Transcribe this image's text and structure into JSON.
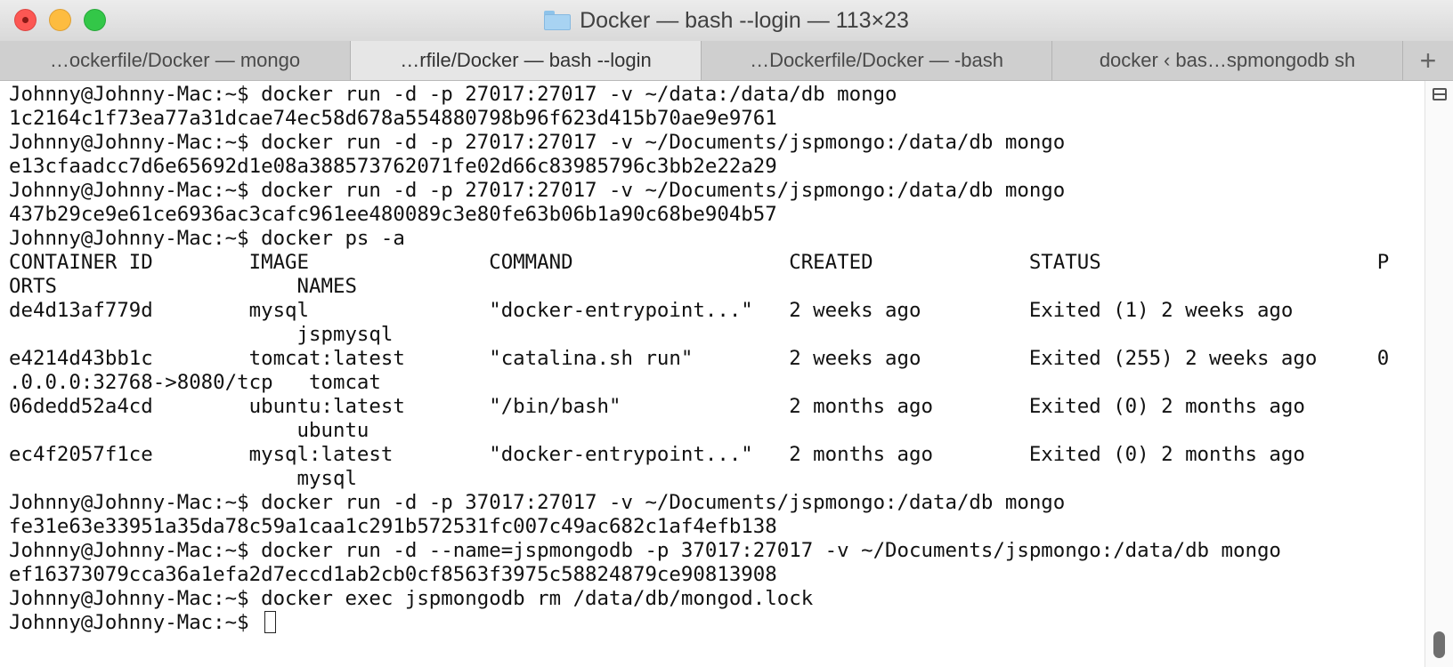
{
  "window": {
    "title": "Docker — bash --login — 113×23"
  },
  "tabs": [
    {
      "label": "…ockerfile/Docker — mongo",
      "active": false
    },
    {
      "label": "…rfile/Docker — bash --login",
      "active": true
    },
    {
      "label": "…Dockerfile/Docker — -bash",
      "active": false
    },
    {
      "label": "docker ‹ bas…spmongodb sh",
      "active": false
    }
  ],
  "add_tab_label": "+",
  "terminal": {
    "lines": [
      "Johnny@Johnny-Mac:~$ docker run -d -p 27017:27017 -v ~/data:/data/db mongo",
      "1c2164c1f73ea77a31dcae74ec58d678a554880798b96f623d415b70ae9e9761",
      "Johnny@Johnny-Mac:~$ docker run -d -p 27017:27017 -v ~/Documents/jspmongo:/data/db mongo",
      "e13cfaadcc7d6e65692d1e08a388573762071fe02d66c83985796c3bb2e22a29",
      "Johnny@Johnny-Mac:~$ docker run -d -p 27017:27017 -v ~/Documents/jspmongo:/data/db mongo",
      "437b29ce9e61ce6936ac3cafc961ee480089c3e80fe63b06b1a90c68be904b57",
      "Johnny@Johnny-Mac:~$ docker ps -a",
      "CONTAINER ID        IMAGE               COMMAND                  CREATED             STATUS                       P",
      "ORTS                    NAMES",
      "de4d13af779d        mysql               \"docker-entrypoint...\"   2 weeks ago         Exited (1) 2 weeks ago",
      "                        jspmysql",
      "e4214d43bb1c        tomcat:latest       \"catalina.sh run\"        2 weeks ago         Exited (255) 2 weeks ago     0",
      ".0.0.0:32768->8080/tcp   tomcat",
      "06dedd52a4cd        ubuntu:latest       \"/bin/bash\"              2 months ago        Exited (0) 2 months ago",
      "                        ubuntu",
      "ec4f2057f1ce        mysql:latest        \"docker-entrypoint...\"   2 months ago        Exited (0) 2 months ago",
      "                        mysql",
      "Johnny@Johnny-Mac:~$ docker run -d -p 37017:27017 -v ~/Documents/jspmongo:/data/db mongo",
      "fe31e63e33951a35da78c59a1caa1c291b572531fc007c49ac682c1af4efb138",
      "Johnny@Johnny-Mac:~$ docker run -d --name=jspmongodb -p 37017:27017 -v ~/Documents/jspmongo:/data/db mongo",
      "ef16373079cca36a1efa2d7eccd1ab2cb0cf8563f3975c58824879ce90813908",
      "Johnny@Johnny-Mac:~$ docker exec jspmongodb rm /data/db/mongod.lock"
    ],
    "prompt": "Johnny@Johnny-Mac:~$ "
  },
  "colors": {
    "close": "#fc5753",
    "minimize": "#fdbc40",
    "maximize": "#33c748",
    "terminal_bg": "#ffffff",
    "terminal_fg": "#111111"
  },
  "icons": {
    "close": "close-button-icon",
    "minimize": "minimize-button-icon",
    "maximize": "zoom-button-icon",
    "folder": "folder-icon",
    "split": "split-pane-icon",
    "cursor": "cursor-block"
  }
}
